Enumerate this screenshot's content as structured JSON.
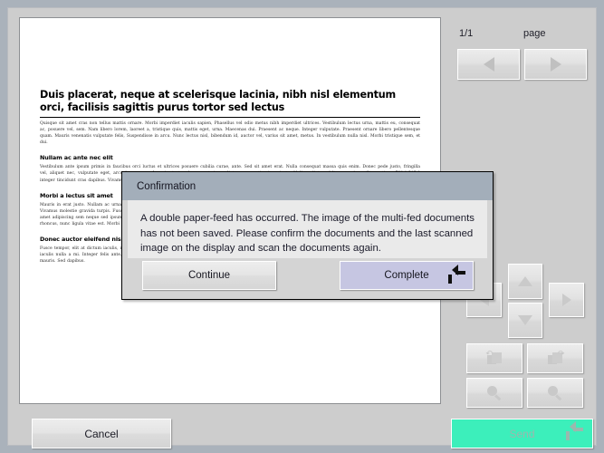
{
  "window": {
    "background_color": "#aab2bb",
    "panel_color": "#cdcdcd"
  },
  "preview": {
    "document": {
      "title": "Duis placerat, neque at scelerisque lacinia, nibh nisl elementum orci, facilisis sagittis purus tortor sed lectus",
      "intro_paragraph": "Quisque sit amet cras non tellus mattis ornare. Morbi imperdiet iaculis sapien, Phasellus vel odio metus nibh imperdiet ultrices. Vestibulum lectus urna, mattis eu, consequat ac, posuere vel, sem. Nam libero lorem, laoreet a, tristique quis, mattis eget, urna. Maecenas dui. Praesent ac neque. Integer vulputate. Praesent ornare libero pellentesque quam. Mauris venenatis vulputate felis, Suspendisse in arcu. Nunc lectus nisl, bibendum id, auctor vel, varius sit amet, metus. In vestibulum nulla nisl. Morbi tristique sem, et dui.",
      "sections": [
        {
          "heading": "Nullam ac ante nec elit",
          "body": "Vestibulum ante ipsum primis in faucibus orci luctus et ultrices posuere cubilia curae, ante. Sed sit amet erat. Nulla consequat massa quis enim. Donec pede justo, fringilla vel, aliquet nec, vulputate eget, arcu hymenaeos. In enim justo, rhoncus ut, imperdiet a, venenatis vitae, justo. Nullam dictum felis eu pede mollis pretium. 782.1.515.0 integer tincidunt cras dapibus. Vivamus elementum semper nisi. Aenean vulputate eleifend tellus sollicitudin wisi."
        },
        {
          "heading": "Morbi a lectus sit amet",
          "body": "Mauris in erat justo. Nullam ac urna eu felis dapibus condimentum sit amet a augue. Sed non neque elit. Aliquam erat volutpat. Donec quis dui at dolor tempor interdum. Vivamus molestie gravida turpis. Fusce lobortis lacus at purus. Nam eget dui. Etiam rhoncus maecenas tempus tellus eget condimentum rhoncus sem quam semper libero sit amet adipiscing sem neque sed ipsum. Diam neque sollicitudin ante. Donec malesuada arcu nec odio pulvinar scelerisque, purus neque pulvinar erat, feugiat pulvinar. Mauris rhoncus, nunc ligula vitae est. Morbi in dui. Quisque et metus. Mauris nunc. Morbi rhoncus vitae lacus congue auctor. Morbi ac mi. Sed convallis elit vehicula cras."
        },
        {
          "heading": "Donec auctor eleifend nisl",
          "body": "Fusce tempor, elit at dictum iaculis, nibh mauris hendrerit nisl, non eleifend enim augue vel metus. Integer lorem odio, gravida vel, hendrerit vitae, aliquam quis, ipsum. Sed iaculis nulla a mi. Integer felis ante, varius nec, interdum ac, egestas in, nisl. Morbi non odio. Proin nec est. Pellentesque interdum velit non diam. Sed varius vulputate mauris. Sed dapibus."
        }
      ]
    }
  },
  "sidebar": {
    "page_counter": "1/1",
    "page_label": "page",
    "buttons": [
      {
        "name": "prev-page-button",
        "icon": "triangle-left-icon",
        "disabled": true
      },
      {
        "name": "next-page-button",
        "icon": "triangle-right-icon",
        "disabled": true
      },
      {
        "name": "pan-up-button",
        "icon": "triangle-up-icon",
        "disabled": true
      },
      {
        "name": "pan-down-button",
        "icon": "triangle-down-icon",
        "disabled": true
      },
      {
        "name": "pan-left-button",
        "icon": "triangle-left-icon",
        "disabled": true
      },
      {
        "name": "pan-right-button",
        "icon": "triangle-right-icon",
        "disabled": true
      },
      {
        "name": "rotate-left-button",
        "icon": "rotate-ccw-icon",
        "disabled": true
      },
      {
        "name": "rotate-right-button",
        "icon": "rotate-cw-icon",
        "disabled": true
      },
      {
        "name": "zoom-out-button",
        "icon": "magnifier-icon",
        "disabled": true
      },
      {
        "name": "zoom-in-button",
        "icon": "magnifier-icon",
        "disabled": true
      }
    ]
  },
  "footer": {
    "cancel_label": "Cancel",
    "send_label": "Send",
    "send_color": "#3cefbb",
    "send_disabled": true
  },
  "dialog": {
    "title": "Confirmation",
    "message": "A double paper-feed has occurred. The image of the multi-fed documents has not been saved. Please confirm the documents and the last scanned image on the display and scan the documents again.",
    "titlebar_color": "#a3aeba",
    "buttons": {
      "continue_label": "Continue",
      "complete_label": "Complete",
      "complete_color": "#c6c6e2",
      "complete_has_enter_key_icon": true
    }
  }
}
